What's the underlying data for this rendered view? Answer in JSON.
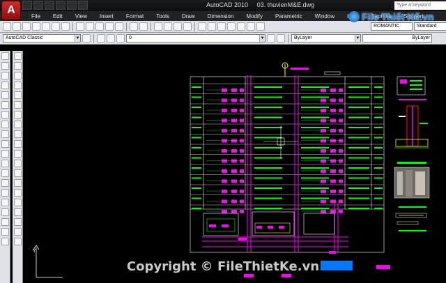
{
  "titlebar": {
    "app": "AutoCAD 2010",
    "document": "03. thuvienM&E.dwg",
    "search_placeholder": "Type a keyword"
  },
  "menu": [
    "File",
    "Edit",
    "View",
    "Insert",
    "Format",
    "Tools",
    "Draw",
    "Dimension",
    "Modify",
    "Parametric",
    "Window",
    "Help",
    "Express",
    "Support"
  ],
  "toolbar": {
    "workspace": "AutoCAD Classic",
    "layer": "0",
    "color": "ByLayer",
    "linetype": "ByLayer",
    "text_style": "ROMANTIC",
    "dim_style": "Standard"
  },
  "drawing": {
    "origin_label": "Y"
  },
  "watermark": {
    "logo_text": "File Thiết Kế.vn",
    "copyright": "Copyright © FileThietKe.vn"
  },
  "colors": {
    "cad_bg": "#000000",
    "magenta": "#ff00ff",
    "green": "#00ff00",
    "yellow": "#ffff00",
    "white": "#ffffff"
  }
}
